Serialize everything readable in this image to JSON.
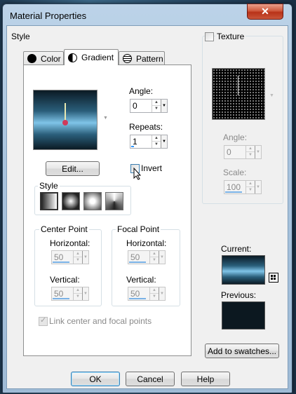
{
  "window": {
    "title": "Material Properties",
    "close_label": "✕"
  },
  "style_group": {
    "label": "Style"
  },
  "tabs": [
    {
      "label": "Color",
      "icon": "color-circle-icon",
      "selected": false
    },
    {
      "label": "Gradient",
      "icon": "gradient-circle-icon",
      "selected": true
    },
    {
      "label": "Pattern",
      "icon": "pattern-globe-icon",
      "selected": false
    }
  ],
  "gradient": {
    "angle_label": "Angle:",
    "angle_value": "0",
    "repeats_label": "Repeats:",
    "repeats_value": "1",
    "edit_label": "Edit...",
    "invert_label": "Invert",
    "invert_checked": false
  },
  "style_sub": {
    "label": "Style",
    "options": [
      "linear-style-icon",
      "rectangular-style-icon",
      "sunburst-style-icon",
      "radial-style-icon"
    ],
    "selected_index": 0
  },
  "center_point": {
    "label": "Center Point",
    "horizontal_label": "Horizontal:",
    "horizontal_value": "50",
    "vertical_label": "Vertical:",
    "vertical_value": "50"
  },
  "focal_point": {
    "label": "Focal Point",
    "horizontal_label": "Horizontal:",
    "horizontal_value": "50",
    "vertical_label": "Vertical:",
    "vertical_value": "50"
  },
  "link_label": "Link center and focal points",
  "texture": {
    "label": "Texture",
    "checked": false,
    "angle_label": "Angle:",
    "angle_value": "0",
    "scale_label": "Scale:",
    "scale_value": "100"
  },
  "current_label": "Current:",
  "previous_label": "Previous:",
  "add_swatches_label": "Add to swatches...",
  "buttons": {
    "ok": "OK",
    "cancel": "Cancel",
    "help": "Help"
  },
  "colors": {
    "gradient_light": "#7fc4e8",
    "gradient_dark": "#0b1a24",
    "previous": "#0c1820",
    "accent": "#3399ff"
  }
}
